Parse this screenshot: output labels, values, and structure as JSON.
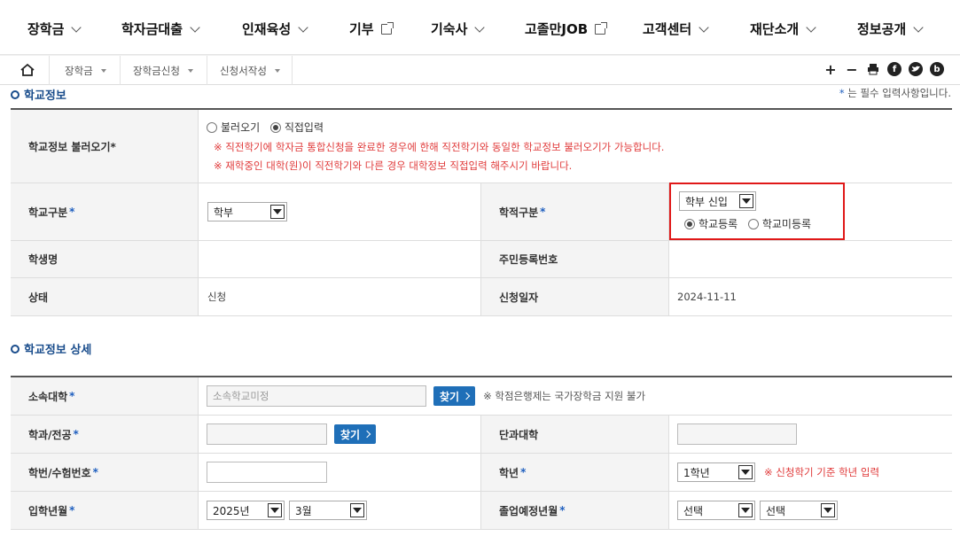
{
  "topnav": {
    "items": [
      {
        "label": "장학금",
        "icon": "chevron-down"
      },
      {
        "label": "학자금대출",
        "icon": "chevron-down"
      },
      {
        "label": "인재육성",
        "icon": "chevron-down"
      },
      {
        "label": "기부",
        "icon": "external-link"
      },
      {
        "label": "기숙사",
        "icon": "chevron-down"
      },
      {
        "label": "고졸만JOB",
        "icon": "external-link"
      },
      {
        "label": "고객센터",
        "icon": "chevron-down"
      },
      {
        "label": "재단소개",
        "icon": "chevron-down"
      },
      {
        "label": "정보공개",
        "icon": "chevron-down"
      }
    ]
  },
  "breadcrumb": {
    "items": [
      "장학금",
      "장학금신청",
      "신청서작성"
    ],
    "tools": [
      "+",
      "−"
    ]
  },
  "section1": {
    "title": "학교정보",
    "required_note_star": "*",
    "required_note": " 는 필수 입력사항입니다."
  },
  "school_info": {
    "load_label": "학교정보 불러오기*",
    "radio_load": "불러오기",
    "radio_direct": "직접입력",
    "warn1": "※ 직전학기에 학자금 통합신청을 완료한 경우에 한해 직전학기와 동일한 학교정보 불러오기가 가능합니다.",
    "warn2": "※ 재학중인 대학(원)이 직전학기와 다른 경우 대학정보 직접입력 해주시기 바랍니다.",
    "school_type_label": "학교구분",
    "school_type_value": "학부",
    "enroll_type_label": "학적구분",
    "enroll_type_value": "학부 신입",
    "radio_registered": "학교등록",
    "radio_unregistered": "학교미등록",
    "student_name_label": "학생명",
    "resident_no_label": "주민등록번호",
    "status_label": "상태",
    "status_value": "신청",
    "apply_date_label": "신청일자",
    "apply_date_value": "2024-11-11"
  },
  "section2": {
    "title": "학교정보 상세"
  },
  "detail": {
    "univ_label": "소속대학",
    "univ_placeholder": "소속학교미정",
    "find_label": "찾기",
    "univ_note": "※ 학점은행제는 국가장학금 지원 불가",
    "major_label": "학과/전공",
    "college_label": "단과대학",
    "student_no_label": "학번/수험번호",
    "grade_label": "학년",
    "grade_value": "1학년",
    "grade_note": "※ 신청학기 기준 학년 입력",
    "entry_label": "입학년월",
    "entry_year": "2025년",
    "entry_month": "3월",
    "grad_label": "졸업예정년월",
    "grad_year": "선택",
    "grad_month": "선택",
    "star": "*"
  }
}
